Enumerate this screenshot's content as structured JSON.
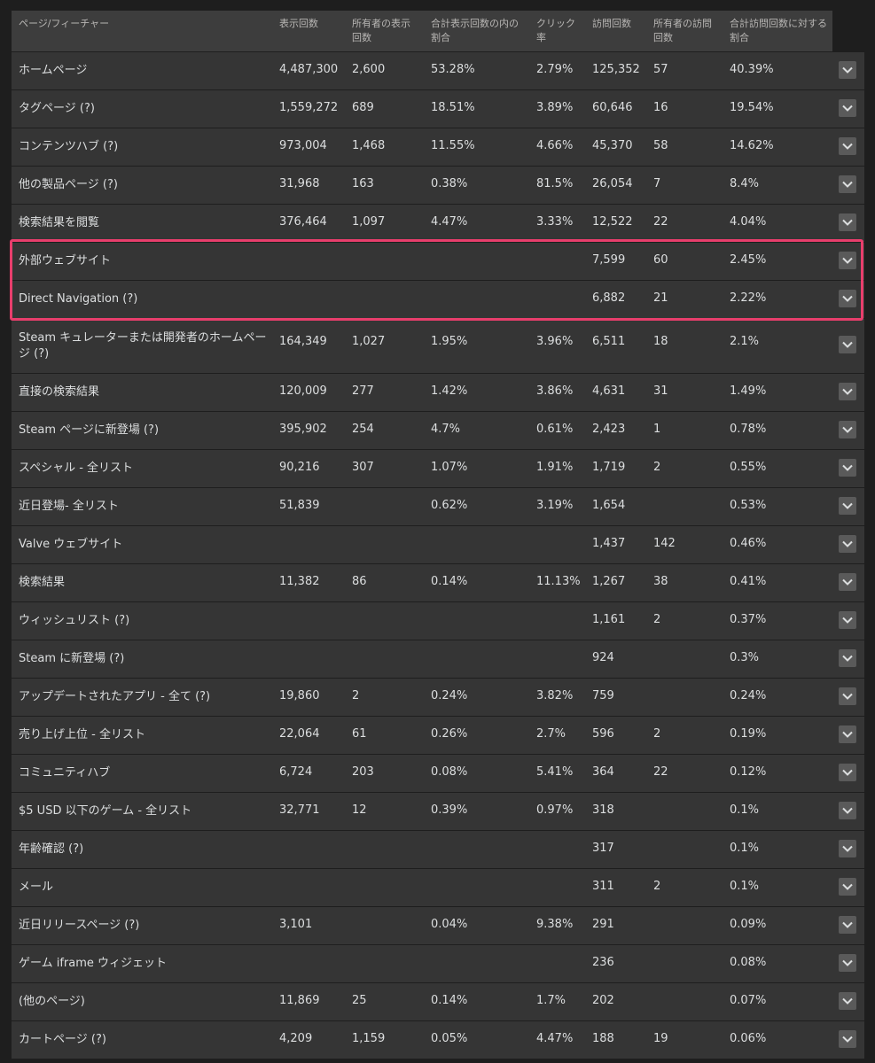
{
  "header": {
    "columns": [
      "ページ/フィーチャー",
      "表示回数",
      "所有者の表示回数",
      "合計表示回数の内の割合",
      "クリック率",
      "訪問回数",
      "所有者の訪問回数",
      "合計訪問回数に対する割合"
    ]
  },
  "highlight_color": "#e83e6c",
  "rows": [
    {
      "name": "ホームページ",
      "impressions": "4,487,300",
      "owner_impressions": "2,600",
      "impression_share": "53.28%",
      "ctr": "2.79%",
      "visits": "125,352",
      "owner_visits": "57",
      "visit_share": "40.39%"
    },
    {
      "name": "タグページ (?)",
      "impressions": "1,559,272",
      "owner_impressions": "689",
      "impression_share": "18.51%",
      "ctr": "3.89%",
      "visits": "60,646",
      "owner_visits": "16",
      "visit_share": "19.54%"
    },
    {
      "name": "コンテンツハブ (?)",
      "impressions": "973,004",
      "owner_impressions": "1,468",
      "impression_share": "11.55%",
      "ctr": "4.66%",
      "visits": "45,370",
      "owner_visits": "58",
      "visit_share": "14.62%"
    },
    {
      "name": "他の製品ページ (?)",
      "impressions": "31,968",
      "owner_impressions": "163",
      "impression_share": "0.38%",
      "ctr": "81.5%",
      "visits": "26,054",
      "owner_visits": "7",
      "visit_share": "8.4%"
    },
    {
      "name": "検索結果を閲覧",
      "impressions": "376,464",
      "owner_impressions": "1,097",
      "impression_share": "4.47%",
      "ctr": "3.33%",
      "visits": "12,522",
      "owner_visits": "22",
      "visit_share": "4.04%"
    },
    {
      "name": "外部ウェブサイト",
      "impressions": "",
      "owner_impressions": "",
      "impression_share": "",
      "ctr": "",
      "visits": "7,599",
      "owner_visits": "60",
      "visit_share": "2.45%"
    },
    {
      "name": "Direct Navigation (?)",
      "impressions": "",
      "owner_impressions": "",
      "impression_share": "",
      "ctr": "",
      "visits": "6,882",
      "owner_visits": "21",
      "visit_share": "2.22%"
    },
    {
      "name": "Steam キュレーターまたは開発者のホームページ (?)",
      "impressions": "164,349",
      "owner_impressions": "1,027",
      "impression_share": "1.95%",
      "ctr": "3.96%",
      "visits": "6,511",
      "owner_visits": "18",
      "visit_share": "2.1%"
    },
    {
      "name": "直接の検索結果",
      "impressions": "120,009",
      "owner_impressions": "277",
      "impression_share": "1.42%",
      "ctr": "3.86%",
      "visits": "4,631",
      "owner_visits": "31",
      "visit_share": "1.49%"
    },
    {
      "name": "Steam ページに新登場 (?)",
      "impressions": "395,902",
      "owner_impressions": "254",
      "impression_share": "4.7%",
      "ctr": "0.61%",
      "visits": "2,423",
      "owner_visits": "1",
      "visit_share": "0.78%"
    },
    {
      "name": "スペシャル - 全リスト",
      "impressions": "90,216",
      "owner_impressions": "307",
      "impression_share": "1.07%",
      "ctr": "1.91%",
      "visits": "1,719",
      "owner_visits": "2",
      "visit_share": "0.55%"
    },
    {
      "name": "近日登場- 全リスト",
      "impressions": "51,839",
      "owner_impressions": "",
      "impression_share": "0.62%",
      "ctr": "3.19%",
      "visits": "1,654",
      "owner_visits": "",
      "visit_share": "0.53%"
    },
    {
      "name": "Valve ウェブサイト",
      "impressions": "",
      "owner_impressions": "",
      "impression_share": "",
      "ctr": "",
      "visits": "1,437",
      "owner_visits": "142",
      "visit_share": "0.46%"
    },
    {
      "name": "検索結果",
      "impressions": "11,382",
      "owner_impressions": "86",
      "impression_share": "0.14%",
      "ctr": "11.13%",
      "visits": "1,267",
      "owner_visits": "38",
      "visit_share": "0.41%"
    },
    {
      "name": "ウィッシュリスト (?)",
      "impressions": "",
      "owner_impressions": "",
      "impression_share": "",
      "ctr": "",
      "visits": "1,161",
      "owner_visits": "2",
      "visit_share": "0.37%"
    },
    {
      "name": "Steam に新登場 (?)",
      "impressions": "",
      "owner_impressions": "",
      "impression_share": "",
      "ctr": "",
      "visits": "924",
      "owner_visits": "",
      "visit_share": "0.3%"
    },
    {
      "name": "アップデートされたアプリ - 全て (?)",
      "impressions": "19,860",
      "owner_impressions": "2",
      "impression_share": "0.24%",
      "ctr": "3.82%",
      "visits": "759",
      "owner_visits": "",
      "visit_share": "0.24%"
    },
    {
      "name": "売り上げ上位 - 全リスト",
      "impressions": "22,064",
      "owner_impressions": "61",
      "impression_share": "0.26%",
      "ctr": "2.7%",
      "visits": "596",
      "owner_visits": "2",
      "visit_share": "0.19%"
    },
    {
      "name": "コミュニティハブ",
      "impressions": "6,724",
      "owner_impressions": "203",
      "impression_share": "0.08%",
      "ctr": "5.41%",
      "visits": "364",
      "owner_visits": "22",
      "visit_share": "0.12%"
    },
    {
      "name": "$5 USD 以下のゲーム - 全リスト",
      "impressions": "32,771",
      "owner_impressions": "12",
      "impression_share": "0.39%",
      "ctr": "0.97%",
      "visits": "318",
      "owner_visits": "",
      "visit_share": "0.1%"
    },
    {
      "name": "年齢確認 (?)",
      "impressions": "",
      "owner_impressions": "",
      "impression_share": "",
      "ctr": "",
      "visits": "317",
      "owner_visits": "",
      "visit_share": "0.1%"
    },
    {
      "name": "メール",
      "impressions": "",
      "owner_impressions": "",
      "impression_share": "",
      "ctr": "",
      "visits": "311",
      "owner_visits": "2",
      "visit_share": "0.1%"
    },
    {
      "name": "近日リリースページ (?)",
      "impressions": "3,101",
      "owner_impressions": "",
      "impression_share": "0.04%",
      "ctr": "9.38%",
      "visits": "291",
      "owner_visits": "",
      "visit_share": "0.09%"
    },
    {
      "name": "ゲーム iframe ウィジェット",
      "impressions": "",
      "owner_impressions": "",
      "impression_share": "",
      "ctr": "",
      "visits": "236",
      "owner_visits": "",
      "visit_share": "0.08%"
    },
    {
      "name": "(他のページ)",
      "impressions": "11,869",
      "owner_impressions": "25",
      "impression_share": "0.14%",
      "ctr": "1.7%",
      "visits": "202",
      "owner_visits": "",
      "visit_share": "0.07%"
    },
    {
      "name": "カートページ (?)",
      "impressions": "4,209",
      "owner_impressions": "1,159",
      "impression_share": "0.05%",
      "ctr": "4.47%",
      "visits": "188",
      "owner_visits": "19",
      "visit_share": "0.06%"
    }
  ],
  "icons": {
    "expand": "chevron-down-icon"
  }
}
